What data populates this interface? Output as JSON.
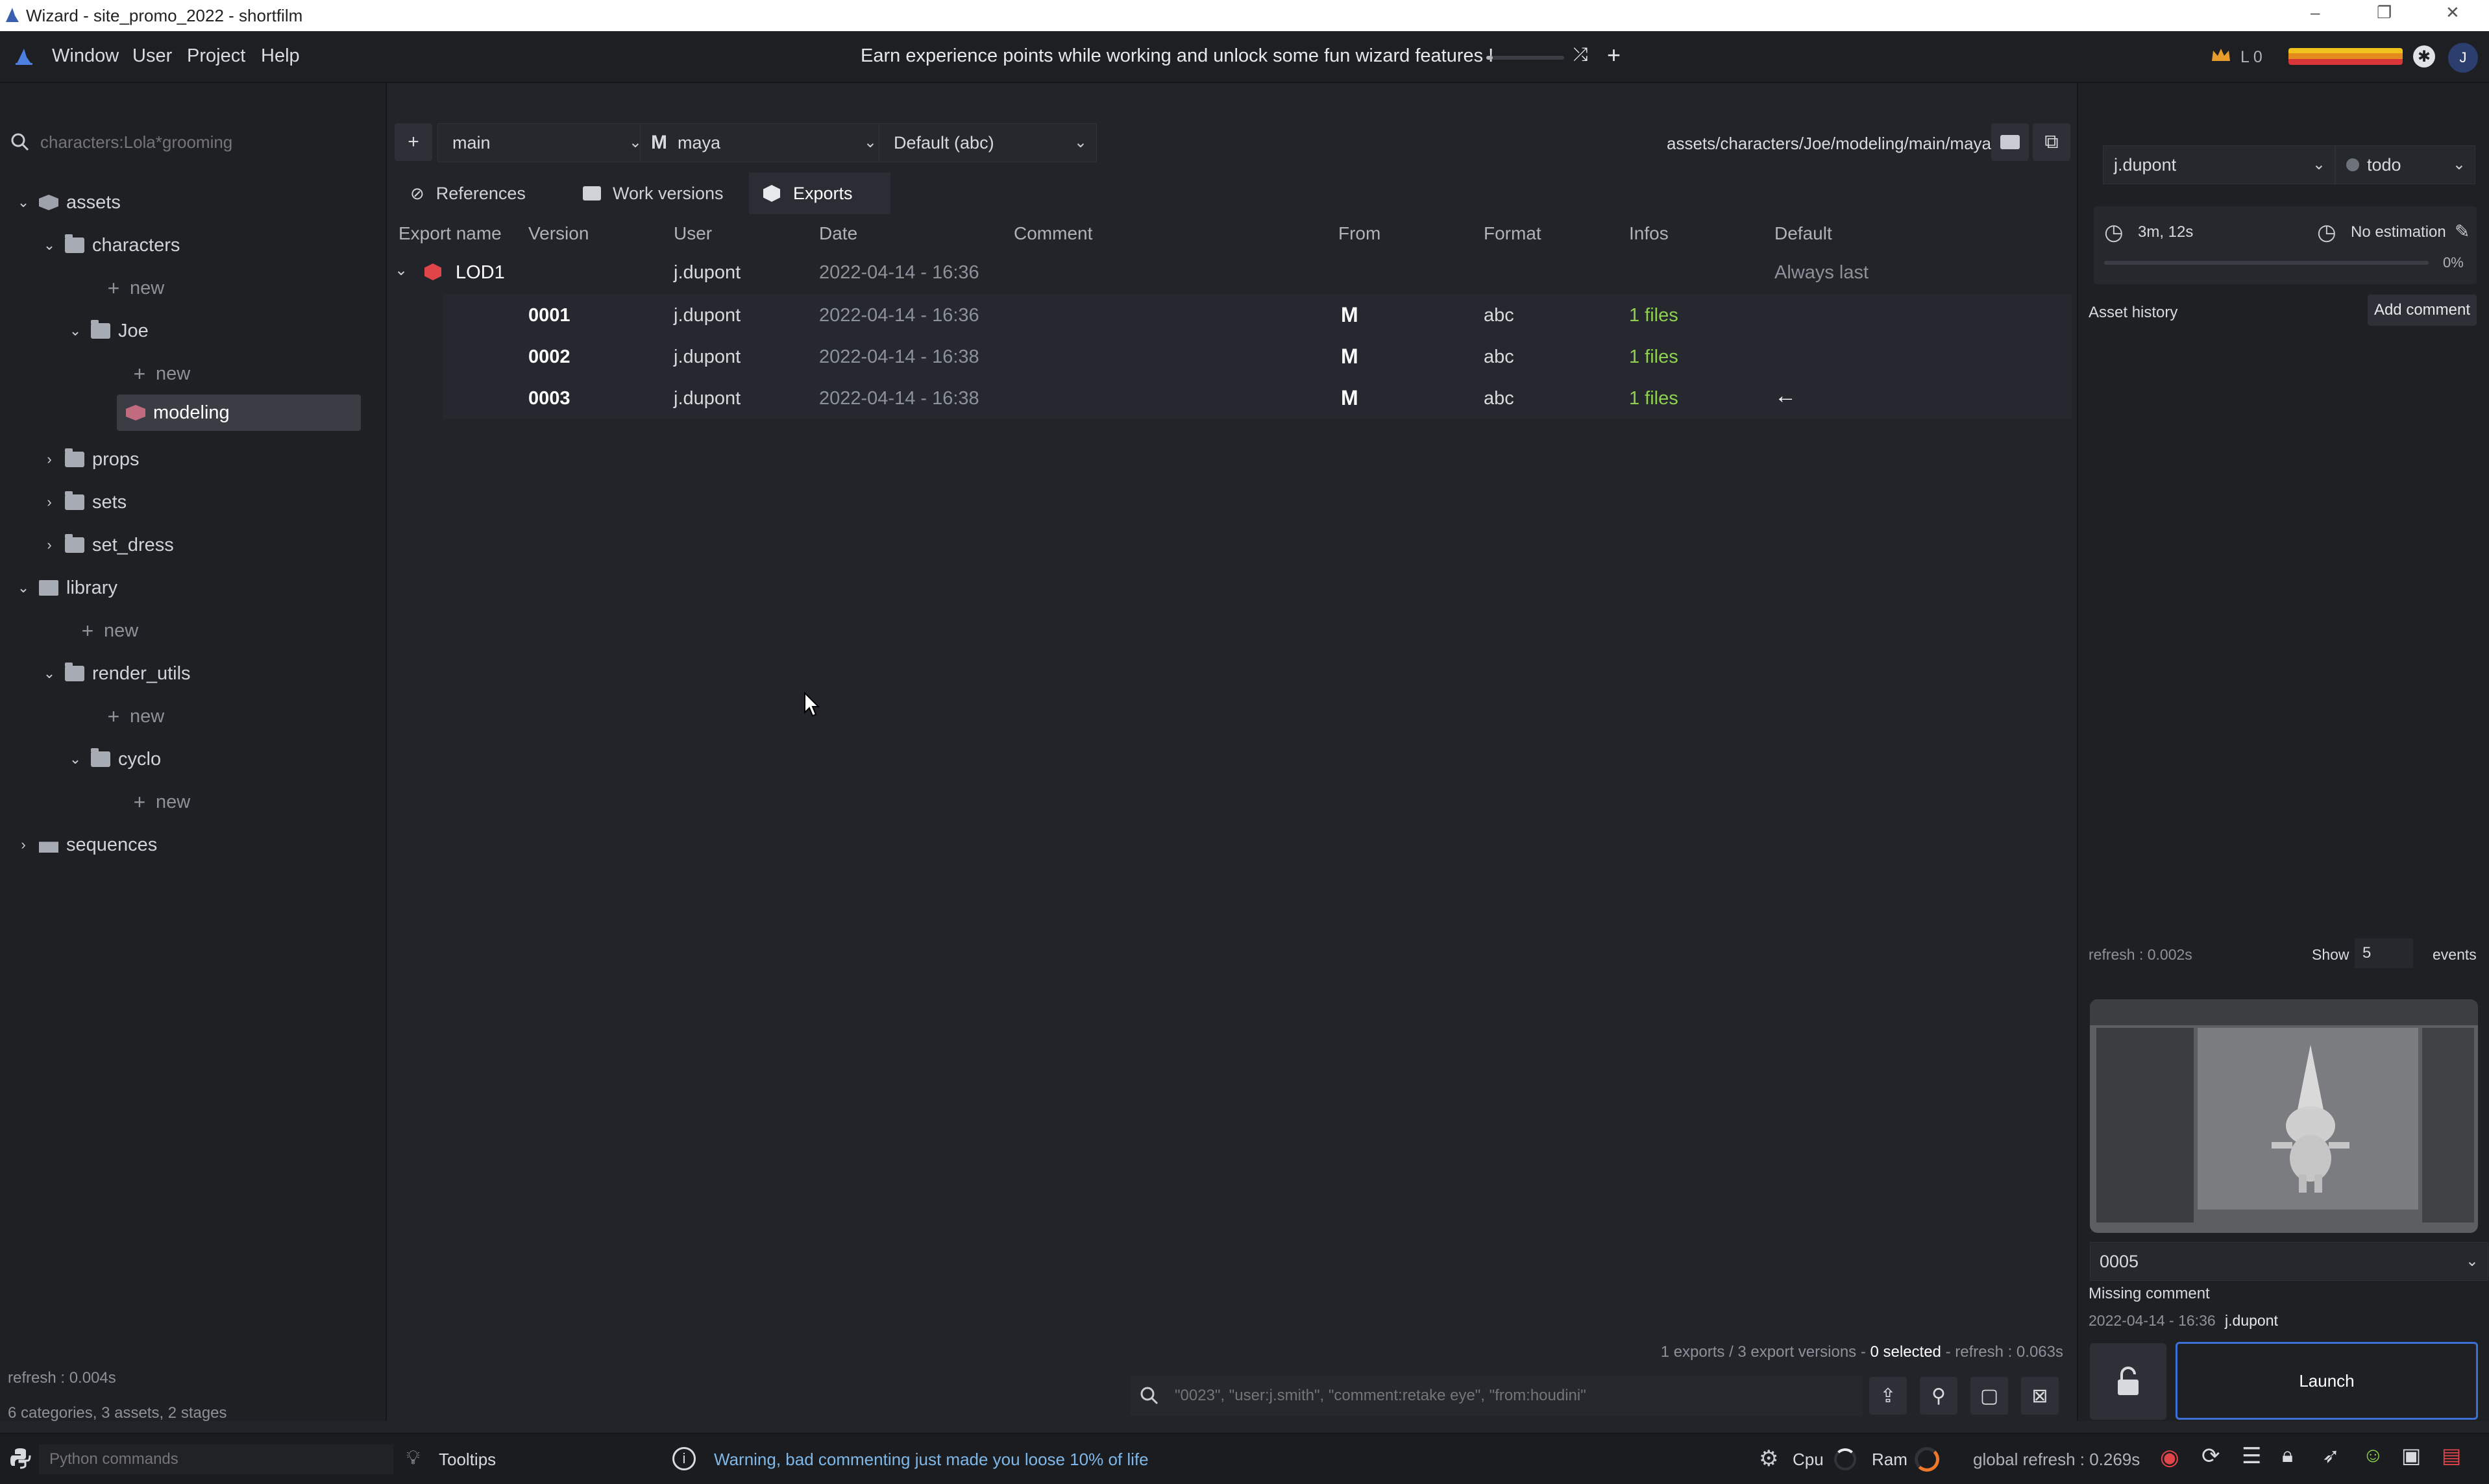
{
  "window": {
    "title": "Wizard - site_promo_2022 - shortfilm",
    "controls": [
      "–",
      "❐",
      "✕"
    ]
  },
  "menu": {
    "items": [
      "Window",
      "User",
      "Project",
      "Help"
    ],
    "promo_text": "Earn experience points while working and unlock some fun wizard features !",
    "level_label": "L 0",
    "avatar_letter": "J"
  },
  "left_panel": {
    "search_placeholder": "characters:Lola*grooming",
    "tree": {
      "assets": "assets",
      "characters": "characters",
      "new1": "new",
      "joe": "Joe",
      "new2": "new",
      "modeling": "modeling",
      "props": "props",
      "sets": "sets",
      "set_dress": "set_dress",
      "library": "library",
      "new3": "new",
      "render_utils": "render_utils",
      "new4": "new",
      "cyclo": "cyclo",
      "new5": "new",
      "sequences": "sequences"
    },
    "refresh_text": "refresh : 0.004s",
    "summary": "6 categories, 3 assets, 2 stages"
  },
  "center": {
    "variant_select": "main",
    "software_select": "maya",
    "format_select": "Default (abc)",
    "path": "assets/characters/Joe/modeling/main/maya",
    "tabs": [
      "References",
      "Work versions",
      "Exports"
    ],
    "active_tab": "Exports",
    "columns": [
      "Export name",
      "Version",
      "User",
      "Date",
      "Comment",
      "From",
      "Format",
      "Infos",
      "Default"
    ],
    "group": {
      "name": "LOD1",
      "user": "j.dupont",
      "date": "2022-04-14 - 16:36",
      "default": "Always last"
    },
    "rows": [
      {
        "version": "0001",
        "user": "j.dupont",
        "date": "2022-04-14 - 16:36",
        "from": "M",
        "format": "abc",
        "infos": "1 files",
        "default": ""
      },
      {
        "version": "0002",
        "user": "j.dupont",
        "date": "2022-04-14 - 16:38",
        "from": "M",
        "format": "abc",
        "infos": "1 files",
        "default": ""
      },
      {
        "version": "0003",
        "user": "j.dupont",
        "date": "2022-04-14 - 16:38",
        "from": "M",
        "format": "abc",
        "infos": "1 files",
        "default": "←"
      }
    ],
    "status_prefix": "1 exports / 3 export versions - ",
    "status_selected": "0 selected",
    "status_refresh": " - refresh : 0.063s",
    "filter_placeholder": "\"0023\", \"user:j.smith\", \"comment:retake eye\", \"from:houdini\""
  },
  "right_panel": {
    "user_select": "j.dupont",
    "state_select": "todo",
    "time_spent": "3m, 12s",
    "estimation": "No estimation",
    "progress": "0%",
    "history_label": "Asset history",
    "add_comment": "Add comment",
    "refresh_text": "refresh : 0.002s",
    "show_label": "Show",
    "show_count": "5",
    "events_label": "events",
    "version_select": "0005",
    "comment": "Missing comment",
    "version_date": "2022-04-14 - 16:36",
    "version_user": "j.dupont",
    "launch": "Launch"
  },
  "bottom": {
    "python_placeholder": "Python commands",
    "tooltips": "Tooltips",
    "warning": "Warning, bad commenting just made you loose 10% of life",
    "cpu": "Cpu",
    "ram": "Ram",
    "global_refresh": "global refresh : 0.269s"
  },
  "colors": {
    "accent_green": "#8fd14f",
    "warning_blue": "#7fb8e8",
    "lod_red": "#e0454a",
    "launch_border": "#3d6fd9"
  }
}
